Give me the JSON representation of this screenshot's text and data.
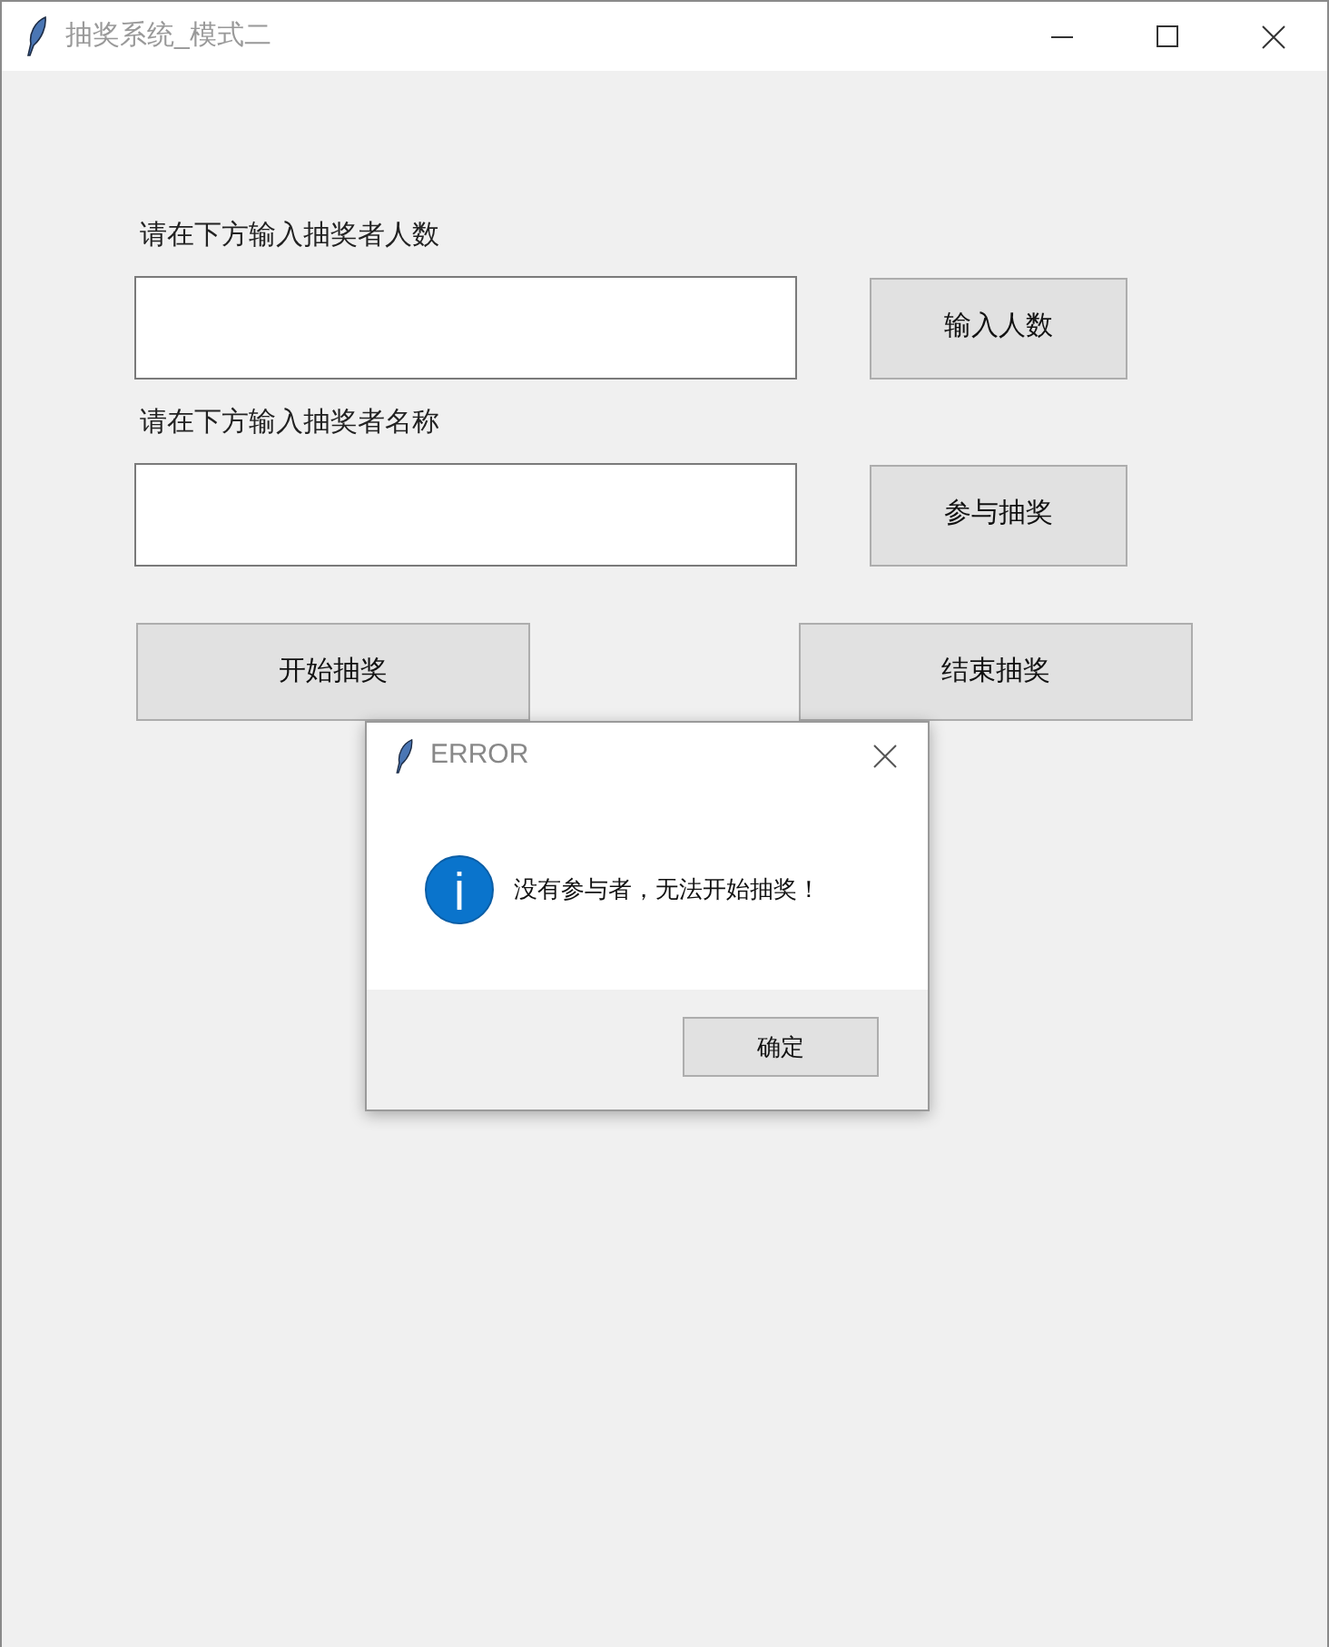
{
  "window": {
    "title": "抽奖系统_模式二"
  },
  "form": {
    "fields": [
      {
        "label": "请在下方输入抽奖者人数",
        "button": "输入人数"
      },
      {
        "label": "请在下方输入抽奖者名称",
        "button": "参与抽奖"
      }
    ],
    "actions": [
      "开始抽奖",
      "结束抽奖"
    ]
  },
  "dialog": {
    "title": "ERROR",
    "message": "没有参与者，无法开始抽奖！",
    "buttons": [
      "确定"
    ]
  }
}
